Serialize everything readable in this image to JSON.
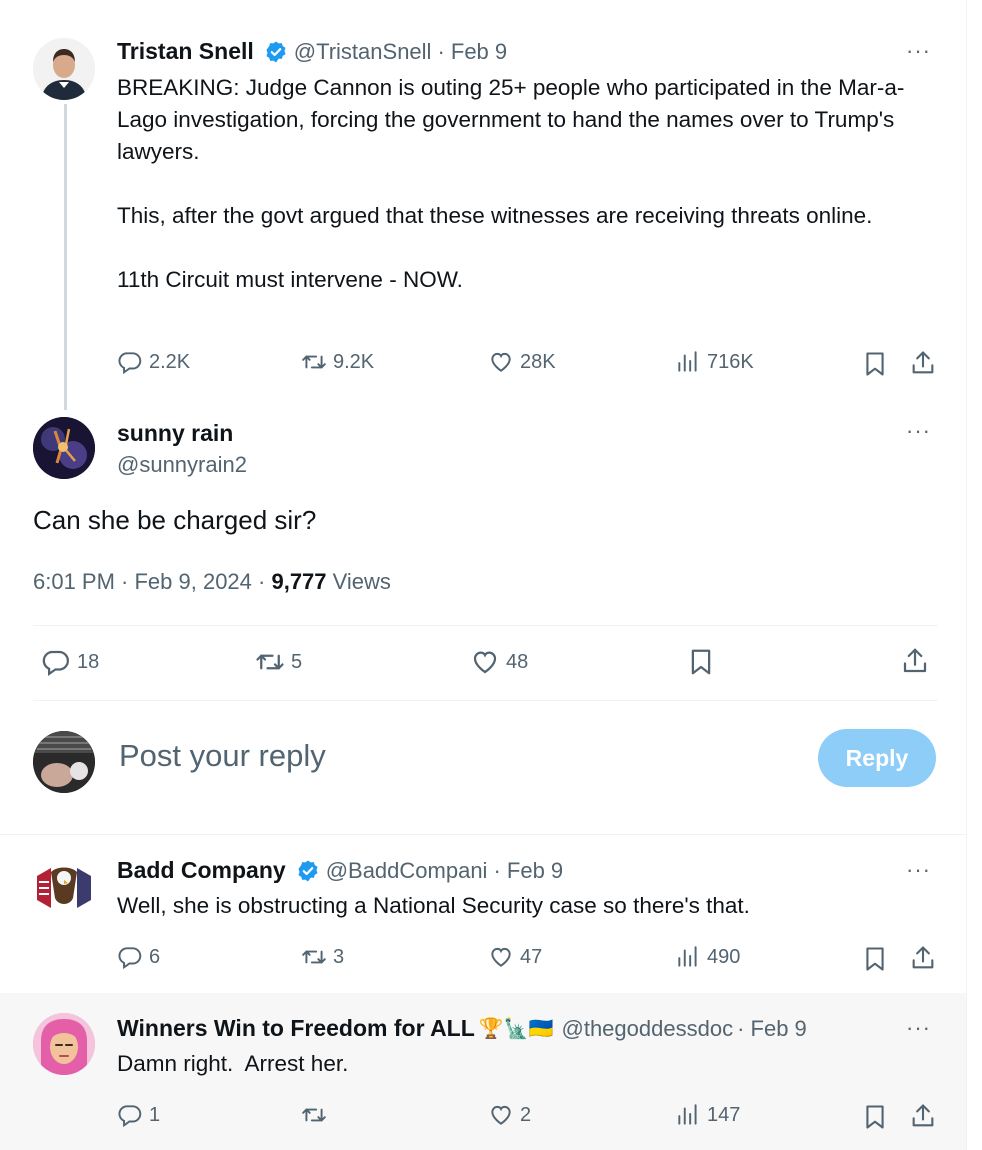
{
  "top_tweet": {
    "name": "Tristan Snell",
    "handle": "@TristanSnell",
    "date": "· Feb 9",
    "paragraphs": [
      "BREAKING: Judge Cannon is outing 25+ people who participated in the Mar-a-Lago investigation, forcing the government to hand the names over to Trump's lawyers.",
      "This, after the govt argued that these witnesses are receiving threats online.",
      "11th Circuit must intervene - NOW."
    ],
    "replies": "2.2K",
    "reposts": "9.2K",
    "likes": "28K",
    "views": "716K"
  },
  "main_tweet": {
    "name": "sunny rain",
    "handle": "@sunnyrain2",
    "text": "Can she be charged sir?",
    "time": "6:01 PM · Feb 9, 2024 · ",
    "views_count": "9,777",
    "views_label": " Views",
    "replies": "18",
    "reposts": "5",
    "likes": "48"
  },
  "composer": {
    "placeholder": "Post your reply",
    "button": "Reply"
  },
  "reply1": {
    "name": "Badd Company",
    "handle": "@BaddCompani",
    "date": "· Feb 9",
    "text": "Well, she is obstructing a National Security case so there's that.",
    "replies": "6",
    "reposts": "3",
    "likes": "47",
    "views": "490"
  },
  "reply2": {
    "name": "Winners Win to Freedom for ALL",
    "emojis": "🏆🗽🇺🇦",
    "handle": "@thegoddessdoc",
    "date": "· Feb 9",
    "text": "Damn right.  Arrest her.",
    "replies": "1",
    "reposts": "",
    "likes": "2",
    "views": "147"
  },
  "more_label": "···",
  "colors": {
    "accent": "#1d9bf0",
    "reply_button_disabled": "#8ecdf8",
    "secondary_text": "#536471"
  }
}
